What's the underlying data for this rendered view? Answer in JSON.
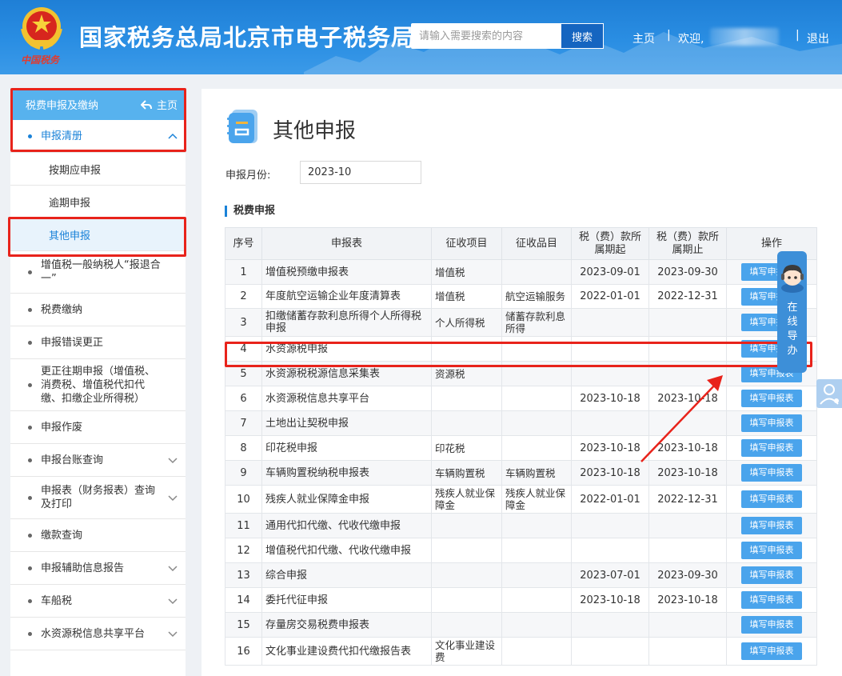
{
  "header": {
    "emblem_text": "中国税务",
    "title": "国家税务总局北京市电子税务局",
    "search_placeholder": "请输入需要搜索的内容",
    "search_button": "搜索",
    "link_home": "主页",
    "sep": "|",
    "welcome": "欢迎,",
    "logout": "退出"
  },
  "sidebar": {
    "header_label": "税费申报及缴纳",
    "home_label": "主页",
    "items": [
      {
        "label": "申报清册"
      },
      {
        "label": "按期应申报"
      },
      {
        "label": "逾期申报"
      },
      {
        "label": "其他申报"
      },
      {
        "label": "增值税一般纳税人“报退合一”"
      },
      {
        "label": "税费缴纳"
      },
      {
        "label": "申报错误更正"
      },
      {
        "label": "更正往期申报（增值税、消费税、增值税代扣代缴、扣缴企业所得税）"
      },
      {
        "label": "申报作废"
      },
      {
        "label": "申报台账查询"
      },
      {
        "label": "申报表（财务报表）查询及打印"
      },
      {
        "label": "缴款查询"
      },
      {
        "label": "申报辅助信息报告"
      },
      {
        "label": "车船税"
      },
      {
        "label": "水资源税信息共享平台"
      }
    ]
  },
  "main": {
    "title": "其他申报",
    "month_label": "申报月份:",
    "month_value": "2023-10",
    "section_title": "税费申报",
    "columns": [
      "序号",
      "申报表",
      "征收项目",
      "征收品目",
      "税（费）款所属期起",
      "税（费）款所属期止",
      "操作"
    ],
    "fill_label": "填写申报表",
    "rows": [
      {
        "no": "1",
        "form": "增值税预缴申报表",
        "item": "增值税",
        "sub": "",
        "start": "2023-09-01",
        "end": "2023-09-30"
      },
      {
        "no": "2",
        "form": "年度航空运输企业年度清算表",
        "item": "增值税",
        "sub": "航空运输服务",
        "start": "2022-01-01",
        "end": "2022-12-31"
      },
      {
        "no": "3",
        "form": "扣缴储蓄存款利息所得个人所得税申报",
        "item": "个人所得税",
        "sub": "储蓄存款利息所得",
        "start": "",
        "end": ""
      },
      {
        "no": "4",
        "form": "水资源税申报",
        "item": "",
        "sub": "",
        "start": "",
        "end": ""
      },
      {
        "no": "5",
        "form": "水资源税税源信息采集表",
        "item": "资源税",
        "sub": "",
        "start": "",
        "end": ""
      },
      {
        "no": "6",
        "form": "水资源税信息共享平台",
        "item": "",
        "sub": "",
        "start": "2023-10-18",
        "end": "2023-10-18"
      },
      {
        "no": "7",
        "form": "土地出让契税申报",
        "item": "",
        "sub": "",
        "start": "",
        "end": ""
      },
      {
        "no": "8",
        "form": "印花税申报",
        "item": "印花税",
        "sub": "",
        "start": "2023-10-18",
        "end": "2023-10-18"
      },
      {
        "no": "9",
        "form": "车辆购置税纳税申报表",
        "item": "车辆购置税",
        "sub": "车辆购置税",
        "start": "2023-10-18",
        "end": "2023-10-18"
      },
      {
        "no": "10",
        "form": "残疾人就业保障金申报",
        "item": "残疾人就业保障金",
        "sub": "残疾人就业保障金",
        "start": "2022-01-01",
        "end": "2022-12-31"
      },
      {
        "no": "11",
        "form": "通用代扣代缴、代收代缴申报",
        "item": "",
        "sub": "",
        "start": "",
        "end": ""
      },
      {
        "no": "12",
        "form": "增值税代扣代缴、代收代缴申报",
        "item": "",
        "sub": "",
        "start": "",
        "end": ""
      },
      {
        "no": "13",
        "form": "综合申报",
        "item": "",
        "sub": "",
        "start": "2023-07-01",
        "end": "2023-09-30"
      },
      {
        "no": "14",
        "form": "委托代征申报",
        "item": "",
        "sub": "",
        "start": "2023-10-18",
        "end": "2023-10-18"
      },
      {
        "no": "15",
        "form": "存量房交易税费申报表",
        "item": "",
        "sub": "",
        "start": "",
        "end": ""
      },
      {
        "no": "16",
        "form": "文化事业建设费代扣代缴报告表",
        "item": "文化事业建设费",
        "sub": "",
        "start": "",
        "end": ""
      }
    ]
  },
  "guide": {
    "label": "在线导办"
  },
  "colors": {
    "header": "#2a8ee3",
    "accent": "#1a82d8",
    "button": "#4aa4ec",
    "highlight": "#e8231b"
  }
}
